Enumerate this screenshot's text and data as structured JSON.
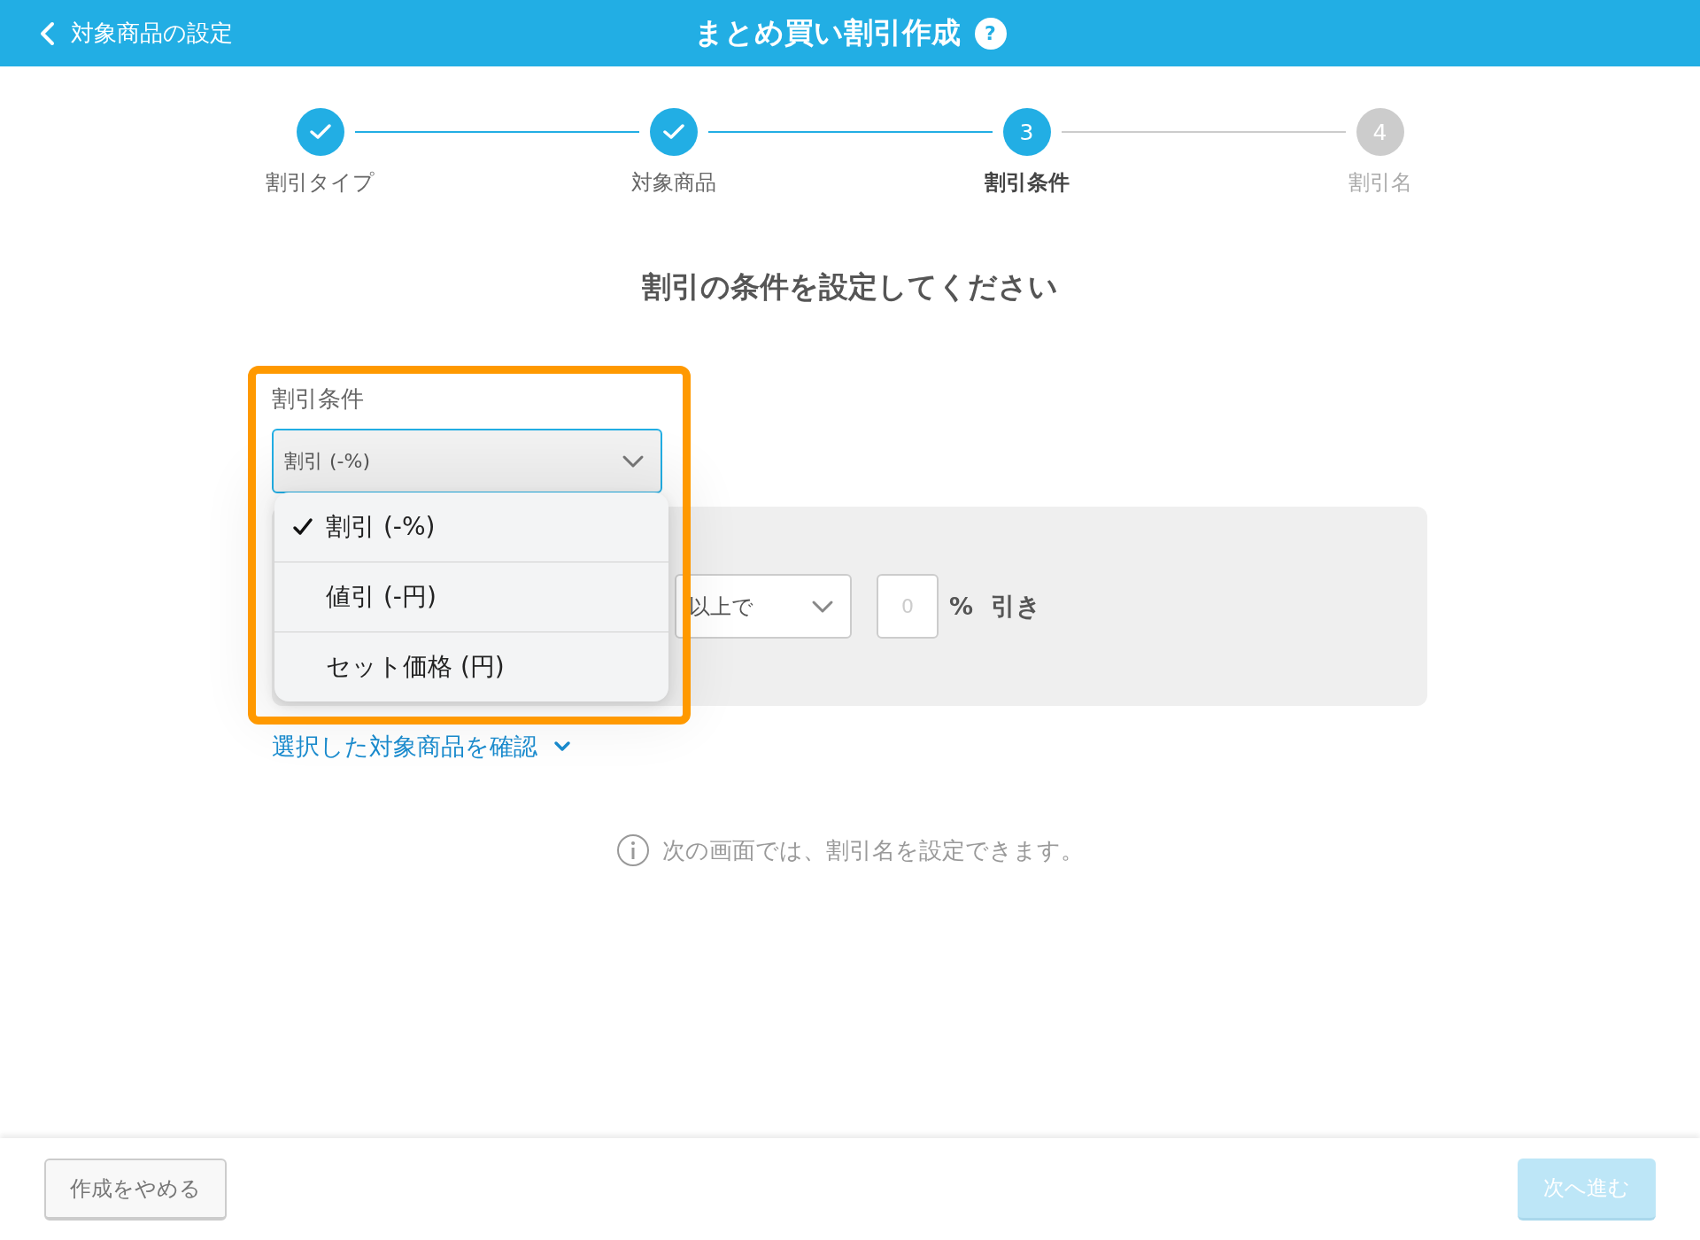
{
  "header": {
    "back_label": "対象商品の設定",
    "title": "まとめ買い割引作成",
    "help": "?"
  },
  "steps": [
    {
      "label": "割引タイプ",
      "completed": true,
      "selected": false
    },
    {
      "label": "対象商品",
      "completed": true,
      "selected": false
    },
    {
      "label": "割引条件",
      "number": "3",
      "completed": false,
      "selected": true
    },
    {
      "label": "割引名",
      "number": "4",
      "completed": false,
      "selected": false
    }
  ],
  "heading": "割引の条件を設定してください",
  "condition": {
    "label": "割引条件",
    "value": "割引 (-%)",
    "expanded": true,
    "options": [
      {
        "label": "割引 (-%)",
        "selected": true
      },
      {
        "label": "値引 (-円)",
        "selected": false
      },
      {
        "label": "セット価格 (円)",
        "selected": false
      }
    ],
    "quantity_select": "以上で",
    "amount_placeholder": "0",
    "unit": "%",
    "suffix": "引き"
  },
  "link": "選択した対象商品を確認",
  "info": "次の画面では、割引名を設定できます。",
  "footer": {
    "cancel": "作成をやめる",
    "next": {
      "label": "次へ進む",
      "disabled": true
    }
  }
}
